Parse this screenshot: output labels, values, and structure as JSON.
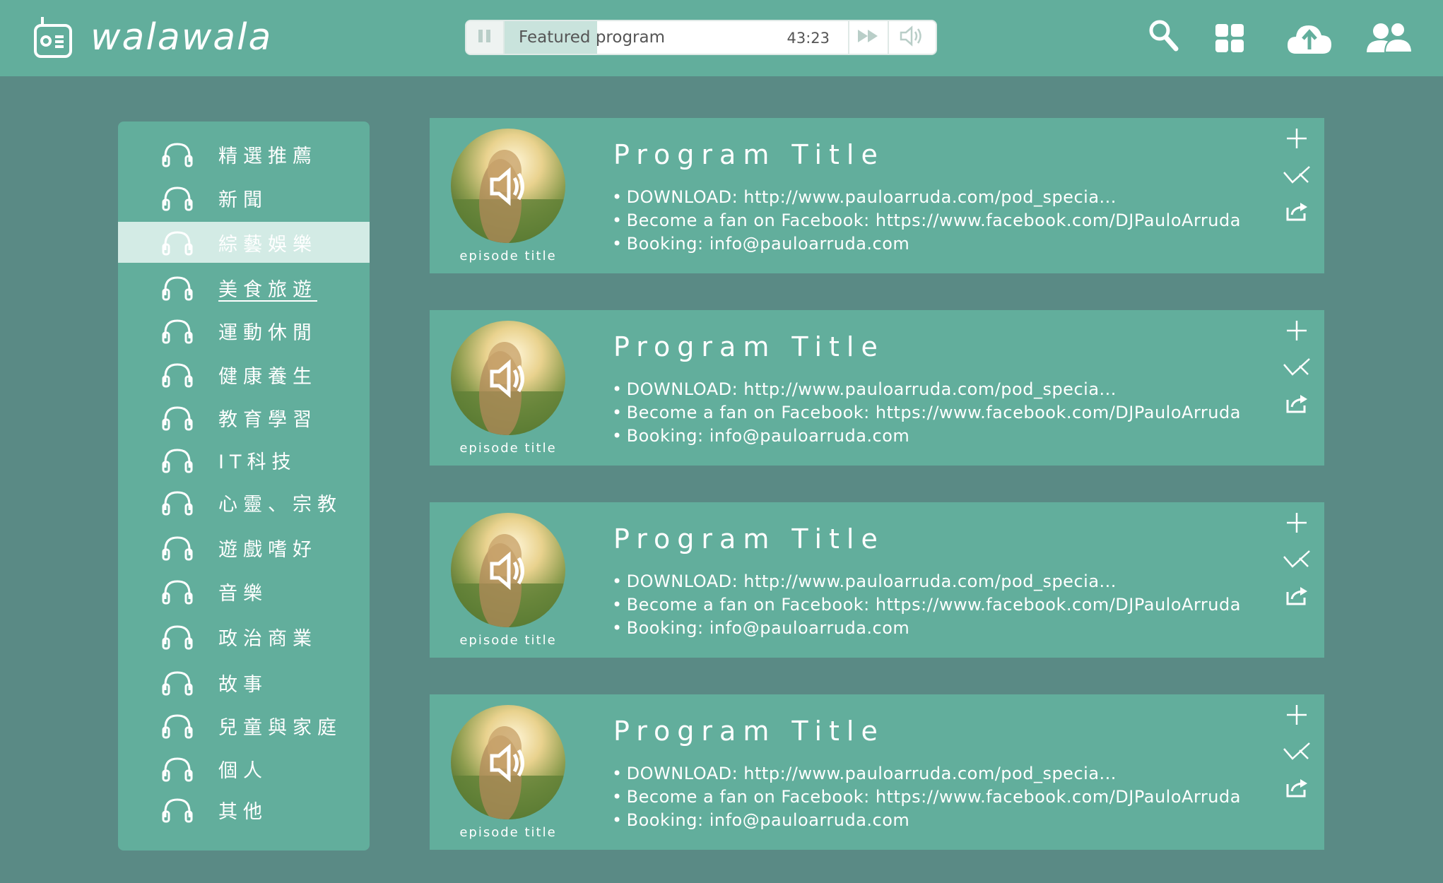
{
  "app": {
    "name": "walawala",
    "icons": {
      "logo": "radio-icon",
      "search": "search-icon",
      "grid": "grid-icon",
      "upload": "cloud-upload-icon",
      "users": "users-icon"
    }
  },
  "player": {
    "track_title": "Featured program",
    "time": "43:23",
    "progress": 0.27,
    "icons": {
      "pause": "pause-icon",
      "next": "fast-forward-icon",
      "volume": "volume-icon"
    }
  },
  "sidebar": {
    "items": [
      {
        "label": "精選推薦"
      },
      {
        "label": "新聞"
      },
      {
        "label": "綜藝娛樂",
        "active": true
      },
      {
        "label": "美食旅遊",
        "underline": true
      },
      {
        "label": "運動休閒"
      },
      {
        "label": "健康養生"
      },
      {
        "label": "教育學習"
      },
      {
        "label": "IT科技"
      },
      {
        "label": "心靈、宗教"
      },
      {
        "label": "遊戲嗜好"
      },
      {
        "label": "音樂"
      },
      {
        "label": "政治商業"
      },
      {
        "label": "故事"
      },
      {
        "label": "兒童與家庭"
      },
      {
        "label": "個人"
      },
      {
        "label": "其他"
      }
    ]
  },
  "programs": [
    {
      "title": "Program Title",
      "episode": "episode title",
      "lines": [
        "DOWNLOAD: http://www.pauloarruda.com/pod_specia...",
        "Become a fan on Facebook: https://www.facebook.com/DJPauloArruda",
        "Booking: info@pauloarruda.com"
      ]
    },
    {
      "title": "Program Title",
      "episode": "episode title",
      "lines": [
        "DOWNLOAD: http://www.pauloarruda.com/pod_specia...",
        "Become a fan on Facebook: https://www.facebook.com/DJPauloArruda",
        "Booking: info@pauloarruda.com"
      ]
    },
    {
      "title": "Program Title",
      "episode": "episode title",
      "lines": [
        "DOWNLOAD: http://www.pauloarruda.com/pod_specia...",
        "Become a fan on Facebook: https://www.facebook.com/DJPauloArruda",
        "Booking: info@pauloarruda.com"
      ]
    },
    {
      "title": "Program Title",
      "episode": "episode title",
      "lines": [
        "DOWNLOAD: http://www.pauloarruda.com/pod_specia...",
        "Become a fan on Facebook: https://www.facebook.com/DJPauloArruda",
        "Booking: info@pauloarruda.com"
      ]
    }
  ],
  "card_actions": [
    "add-icon",
    "check-icon",
    "share-icon"
  ],
  "colors": {
    "background": "#5a8a85",
    "panel": "#62ae9c",
    "active_item": "#d3ebe5",
    "text": "#ffffff"
  }
}
